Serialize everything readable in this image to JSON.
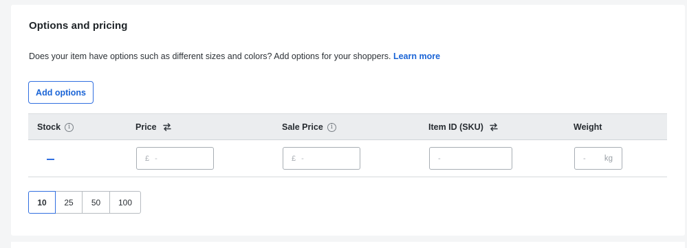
{
  "section": {
    "title": "Options and pricing",
    "description": "Does your item have options such as different sizes and colors? Add options for your shoppers.",
    "learn_more": "Learn more",
    "add_options_label": "Add options"
  },
  "table": {
    "columns": [
      {
        "label": "Stock",
        "icon": "info-icon"
      },
      {
        "label": "Price",
        "icon": "swap-arrows-icon"
      },
      {
        "label": "Sale Price",
        "icon": "info-icon"
      },
      {
        "label": "Item ID (SKU)",
        "icon": "swap-arrows-icon"
      },
      {
        "label": "Weight",
        "icon": ""
      }
    ],
    "row": {
      "stock_value": "—",
      "price": {
        "currency": "£",
        "placeholder": "-"
      },
      "sale_price": {
        "currency": "£",
        "placeholder": "-"
      },
      "sku": {
        "placeholder": "-"
      },
      "weight": {
        "placeholder": "-",
        "unit": "kg"
      }
    }
  },
  "pagination": {
    "page_sizes": [
      "10",
      "25",
      "50",
      "100"
    ],
    "selected": "10"
  },
  "colors": {
    "accent": "#2f6ee0",
    "link": "#1a64d6",
    "header_bg": "#ebedef",
    "page_bg": "#f4f5f6"
  }
}
